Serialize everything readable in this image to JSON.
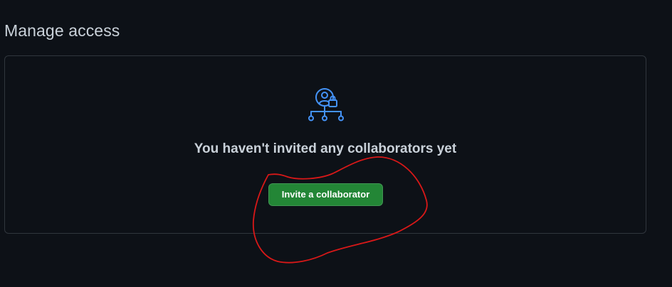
{
  "section": {
    "title": "Manage access"
  },
  "empty_state": {
    "icon": "person-lock-hierarchy-icon",
    "message": "You haven't invited any collaborators yet",
    "invite_button_label": "Invite a collaborator"
  },
  "colors": {
    "background": "#0d1117",
    "border": "#30363d",
    "text": "#c9d1d9",
    "icon_accent": "#4493f8",
    "button_green": "#238636",
    "annotation_red": "#d81818"
  }
}
